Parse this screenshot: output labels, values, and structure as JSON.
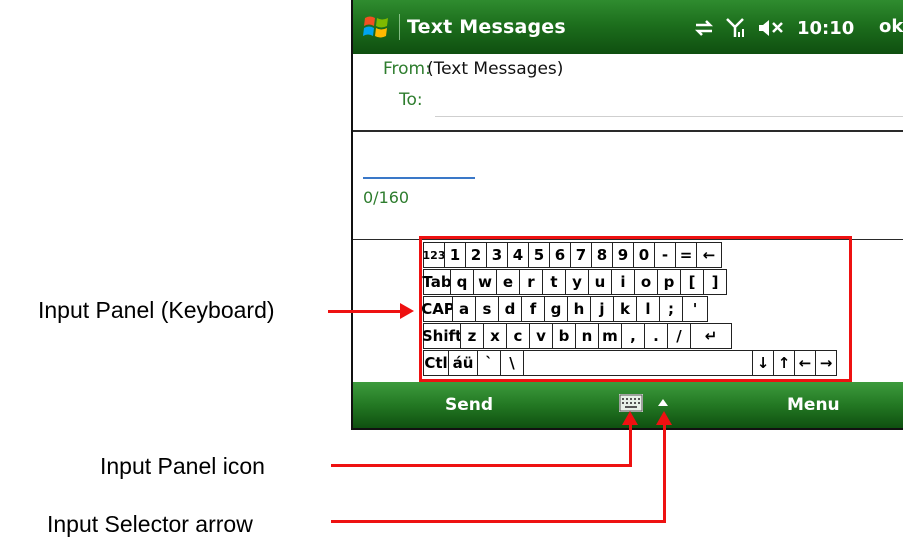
{
  "titlebar": {
    "title": "Text Messages",
    "time": "10:10",
    "ok": "ok",
    "icons": [
      "start-menu-icon",
      "sync-icon",
      "signal-icon",
      "volume-muted-icon"
    ]
  },
  "compose": {
    "from_label": "From:",
    "from_value": "(Text Messages)",
    "to_label": "To:",
    "to_value": "",
    "counter": "0/160"
  },
  "keyboard": {
    "rows": [
      [
        "123",
        "1",
        "2",
        "3",
        "4",
        "5",
        "6",
        "7",
        "8",
        "9",
        "0",
        "-",
        "=",
        "←"
      ],
      [
        "Tab",
        "q",
        "w",
        "e",
        "r",
        "t",
        "y",
        "u",
        "i",
        "o",
        "p",
        "[",
        "]"
      ],
      [
        "CAP",
        "a",
        "s",
        "d",
        "f",
        "g",
        "h",
        "j",
        "k",
        "l",
        ";",
        "'"
      ],
      [
        "Shift",
        "z",
        "x",
        "c",
        "v",
        "b",
        "n",
        "m",
        ",",
        ".",
        "/",
        "↵"
      ],
      [
        "Ctl",
        "áü",
        "`",
        "\\",
        " ",
        "↓",
        "↑",
        "←",
        "→"
      ]
    ]
  },
  "softkeys": {
    "left": "Send",
    "right": "Menu"
  },
  "annotations": {
    "input_panel": "Input Panel (Keyboard)",
    "input_panel_icon": "Input Panel icon",
    "input_selector_arrow": "Input Selector arrow"
  },
  "colors": {
    "titlebar_green": "#1d6f1d",
    "label_green": "#2e7d2e",
    "annotation_red": "#ee1111"
  }
}
